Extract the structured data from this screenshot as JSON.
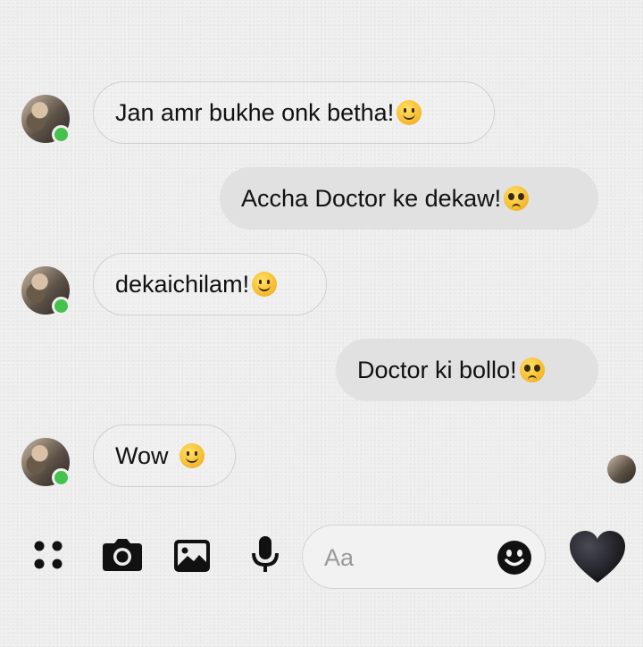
{
  "messages": [
    {
      "side": "incoming",
      "text": "Jan amr bukhe onk betha!",
      "emoji": "slightly-smiling-face"
    },
    {
      "side": "outgoing",
      "text": "Accha Doctor ke dekaw!",
      "emoji": "pleading-face"
    },
    {
      "side": "incoming",
      "text": "dekaichilam!",
      "emoji": "slightly-smiling-face"
    },
    {
      "side": "outgoing",
      "text": "Doctor ki bollo!",
      "emoji": "pleading-face"
    },
    {
      "side": "incoming",
      "text": "Wow",
      "emoji": "slightly-smiling-face"
    }
  ],
  "composer": {
    "placeholder": "Aa"
  },
  "toolbar": {
    "icons": [
      "menu-dots-icon",
      "camera-icon",
      "image-icon",
      "microphone-icon",
      "emoji-icon",
      "heart-icon"
    ]
  },
  "colors": {
    "online": "#45c24d",
    "outgoing_bubble": "#e1e1e1",
    "heart": "#1f1f24"
  }
}
